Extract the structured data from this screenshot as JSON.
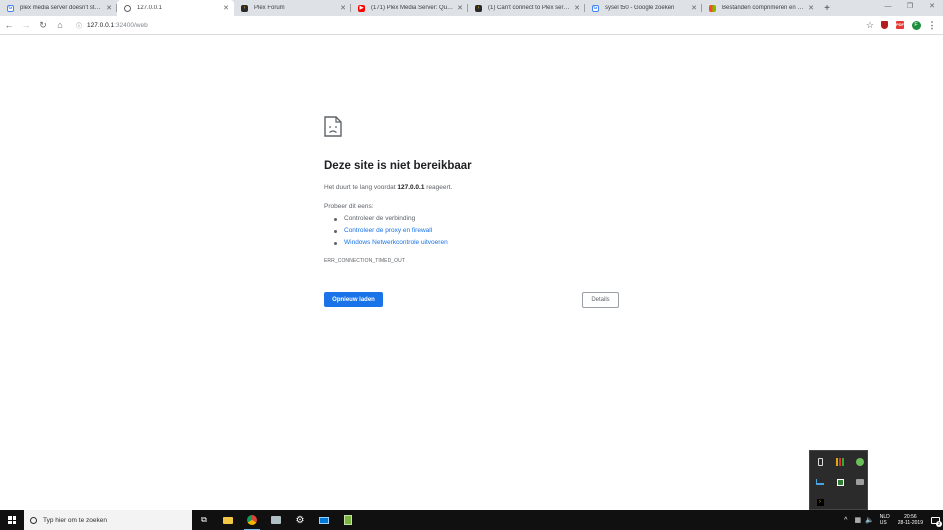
{
  "tabs": [
    {
      "title": "plex media server doesn't start - ",
      "favicon": "google-icon",
      "active": false
    },
    {
      "title": "127.0.0.1",
      "favicon": "globe-icon",
      "active": true
    },
    {
      "title": "Plex Forum",
      "favicon": "plex-icon",
      "active": false
    },
    {
      "title": "(171) Plex Media Server: Quick S",
      "favicon": "youtube-icon",
      "active": false
    },
    {
      "title": "(1) Can't connect to Plex server - ",
      "favicon": "plex-icon",
      "active": false
    },
    {
      "title": "sysel t50 - Google zoeken",
      "favicon": "google-icon",
      "active": false
    },
    {
      "title": "Bestanden comprimeren en dec",
      "favicon": "microsoft-icon",
      "active": false
    }
  ],
  "new_tab_glyph": "+",
  "window_controls": {
    "minimize": "—",
    "restore": "❐",
    "close": "✕"
  },
  "address": {
    "host": "127.0.0.1",
    "path": ":32400/web"
  },
  "profile_initial": "F",
  "pdf_ext_label": "PDF",
  "error": {
    "title": "Deze site is niet bereikbaar",
    "message_prefix": "Het duurt te lang voordat ",
    "message_host": "127.0.0.1",
    "message_suffix": " reageert.",
    "try_label": "Probeer dit eens:",
    "suggestions": [
      {
        "text": "Controleer de verbinding",
        "link": false
      },
      {
        "text": "Controleer de proxy en firewall",
        "link": true
      },
      {
        "text": "Windows Netwerkcontrole uitvoeren",
        "link": true
      }
    ],
    "code": "ERR_CONNECTION_TIMED_OUT",
    "reload_label": "Opnieuw laden",
    "details_label": "Details"
  },
  "taskbar": {
    "search_placeholder": "Typ hier om te zoeken",
    "lang_top": "NLD",
    "lang_bottom": "US",
    "time": "20:56",
    "date": "28-11-2019",
    "notification_count": "2"
  },
  "colors": {
    "accent": "#1a73e8",
    "tabstrip": "#dee1e6",
    "taskbar": "#101010"
  }
}
